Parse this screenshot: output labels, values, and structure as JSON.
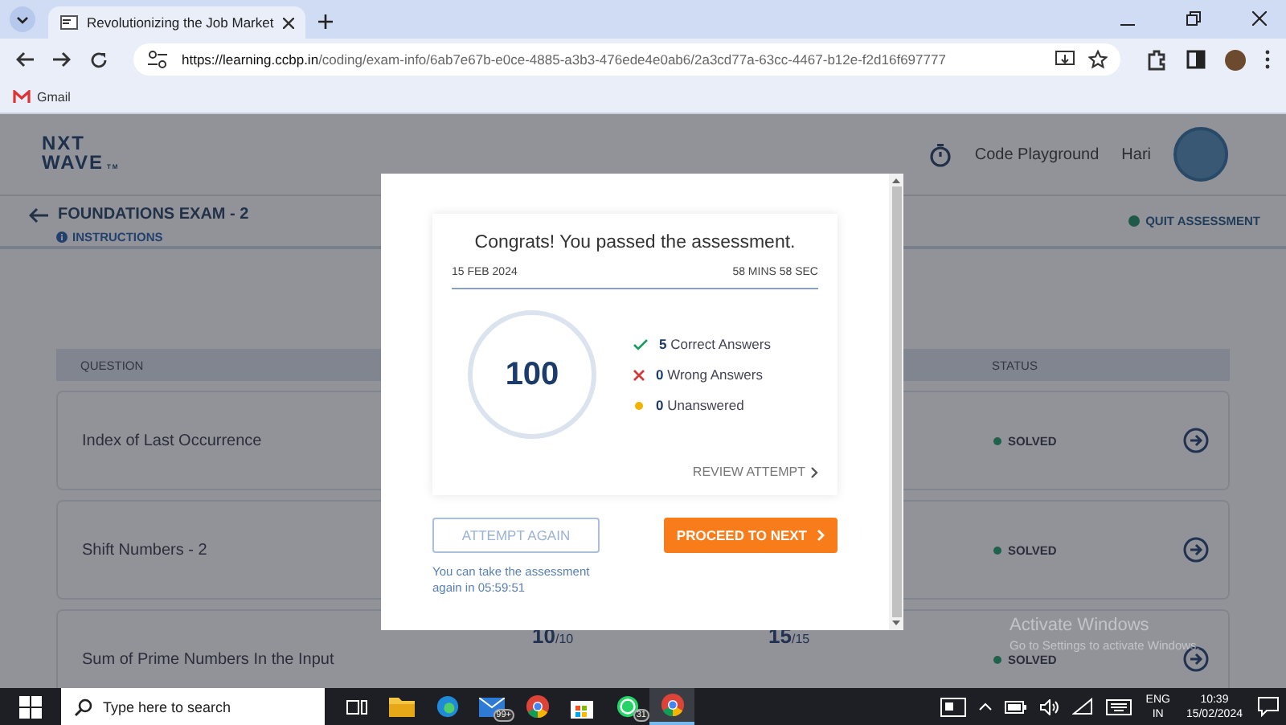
{
  "browser": {
    "tab_title": "Revolutionizing the Job Market",
    "url_host": "https://learning.ccbp.in",
    "url_path": "/coding/exam-info/6ab7e67b-e0ce-4885-a3b3-476ede4e0ab6/2a3cd77a-63cc-4467-b12e-f2d16f697777",
    "bookmarks": [
      "Gmail"
    ]
  },
  "header": {
    "logo": [
      "NXT",
      "WAVE"
    ],
    "logo_mark": "TM",
    "nav_link": "Code Playground",
    "user": "Hari"
  },
  "exam": {
    "title": "FOUNDATIONS EXAM - 2",
    "instructions": "INSTRUCTIONS",
    "quit": "QUIT ASSESSMENT"
  },
  "table": {
    "columns": [
      "QUESTION",
      "STATUS"
    ],
    "rows": [
      {
        "question": "Index of Last Occurrence",
        "status": "SOLVED",
        "scores": []
      },
      {
        "question": "Shift Numbers - 2",
        "status": "SOLVED",
        "scores": []
      },
      {
        "question": "Sum of Prime Numbers In the Input",
        "status": "SOLVED",
        "scores": [
          "10$_{/10}$",
          "15$_{/15}$"
        ]
      }
    ]
  },
  "modal": {
    "title": "Congrats! You passed the assessment.",
    "date": "15 FEB 2024",
    "duration": "58 MINS 58 SEC",
    "score": "100",
    "results": [
      {
        "kind": "correct",
        "count": "5",
        "label": "Correct Answers"
      },
      {
        "kind": "wrong",
        "count": "0",
        "label": "Wrong Answers"
      },
      {
        "kind": "unanswered",
        "count": "0",
        "label": "Unanswered"
      }
    ],
    "review": "REVIEW ATTEMPT",
    "attempt_again": {
      "label": "ATTEMPT AGAIN",
      "disabled": true
    },
    "proceed": "PROCEED TO NEXT",
    "note": "You can take the assessment again in 05:59:51"
  },
  "os_notice": {
    "title": "Activate Windows",
    "subtitle": "Go to Settings to activate Windows."
  },
  "taskbar": {
    "search_placeholder": "Type here to search",
    "apps": [
      {
        "kind": "taskview",
        "active": false
      },
      {
        "kind": "folder",
        "active": false
      },
      {
        "kind": "edge",
        "active": false
      },
      {
        "kind": "mail",
        "badge": "99+",
        "active": false
      },
      {
        "kind": "chrome",
        "active": false
      },
      {
        "kind": "store",
        "active": false
      },
      {
        "kind": "whatsapp",
        "badge": "31",
        "active": false
      },
      {
        "kind": "chrome",
        "active": true
      }
    ],
    "lang": [
      "ENG",
      "IN"
    ],
    "time": "10:39",
    "date": "15/02/2024"
  }
}
